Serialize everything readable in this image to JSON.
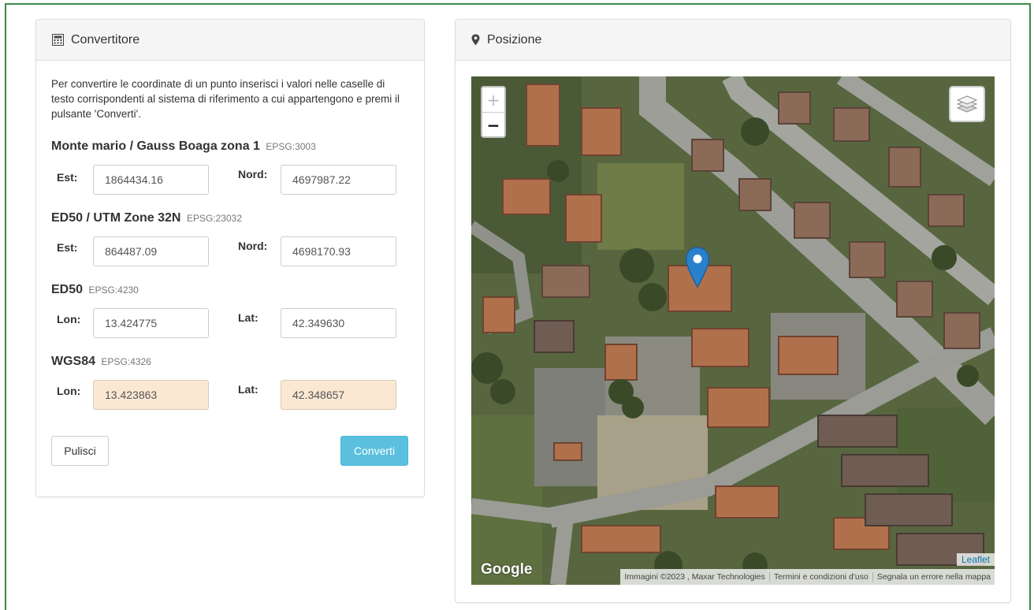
{
  "converter": {
    "title": "Convertitore",
    "icon": "calculator-icon",
    "intro": "Per convertire le coordinate di un punto inserisci i valori nelle caselle di testo corrispondenti al sistema di riferimento a cui appartengono e premi il pulsante 'Converti'.",
    "systems": [
      {
        "name": "Monte mario / Gauss Boaga zona 1",
        "epsg": "EPSG:3003",
        "label1": "Est:",
        "value1": "1864434.16",
        "label2": "Nord:",
        "value2": "4697987.22"
      },
      {
        "name": "ED50 / UTM Zone 32N",
        "epsg": "EPSG:23032",
        "label1": "Est:",
        "value1": "864487.09",
        "label2": "Nord:",
        "value2": "4698170.93"
      },
      {
        "name": "ED50",
        "epsg": "EPSG:4230",
        "label1": "Lon:",
        "value1": "13.424775",
        "label2": "Lat:",
        "value2": "42.349630"
      },
      {
        "name": "WGS84",
        "epsg": "EPSG:4326",
        "label1": "Lon:",
        "value1": "13.423863",
        "label2": "Lat:",
        "value2": "42.348657"
      }
    ],
    "clear_label": "Pulisci",
    "convert_label": "Converti",
    "highlight_color": "#fbe8d3",
    "convert_color": "#5bc0de"
  },
  "position": {
    "title": "Posizione",
    "icon": "map-marker-icon",
    "zoom_in": "+",
    "zoom_out": "−",
    "leaflet": "Leaflet",
    "google": "Google",
    "attribution": [
      "Immagini ©2023 , Maxar Technologies",
      "Termini e condizioni d'uso",
      "Segnala un errore nella mappa"
    ],
    "marker_color": "#2a81cb"
  }
}
